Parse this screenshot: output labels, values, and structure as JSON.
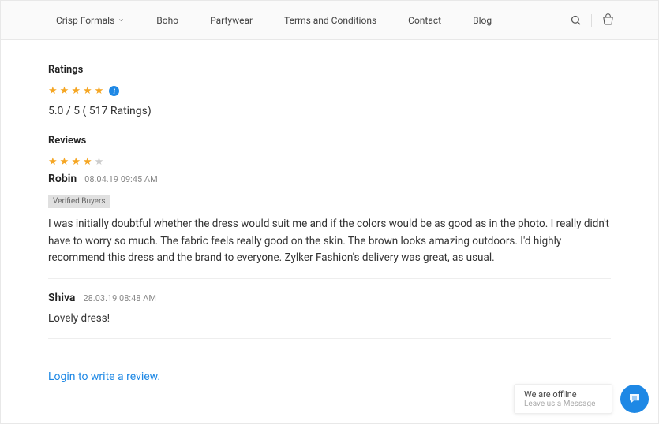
{
  "nav": {
    "items": [
      {
        "label": "Crisp Formals",
        "dropdown": true
      },
      {
        "label": "Boho"
      },
      {
        "label": "Partywear"
      },
      {
        "label": "Terms and Conditions"
      },
      {
        "label": "Contact"
      },
      {
        "label": "Blog"
      }
    ]
  },
  "ratings": {
    "heading": "Ratings",
    "stars_filled": 5,
    "summary": "5.0 / 5 ( 517 Ratings)"
  },
  "reviews_heading": "Reviews",
  "reviews": [
    {
      "stars_filled": 4,
      "author": "Robin",
      "date": "08.04.19 09:45 AM",
      "verified_label": "Verified Buyers",
      "body": "I was initially doubtful whether the dress would suit me and if the colors would be as good as in the photo. I really didn't have to worry so much. The fabric feels really good on the skin. The brown looks amazing outdoors. I'd highly recommend this dress and the brand to everyone. Zylker Fashion's delivery was great, as usual."
    },
    {
      "author": "Shiva",
      "date": "28.03.19 08:48 AM",
      "body": "Lovely dress!"
    }
  ],
  "login_prompt": "Login to write a review.",
  "chat": {
    "title": "We are offline",
    "subtitle": "Leave us a Message"
  }
}
